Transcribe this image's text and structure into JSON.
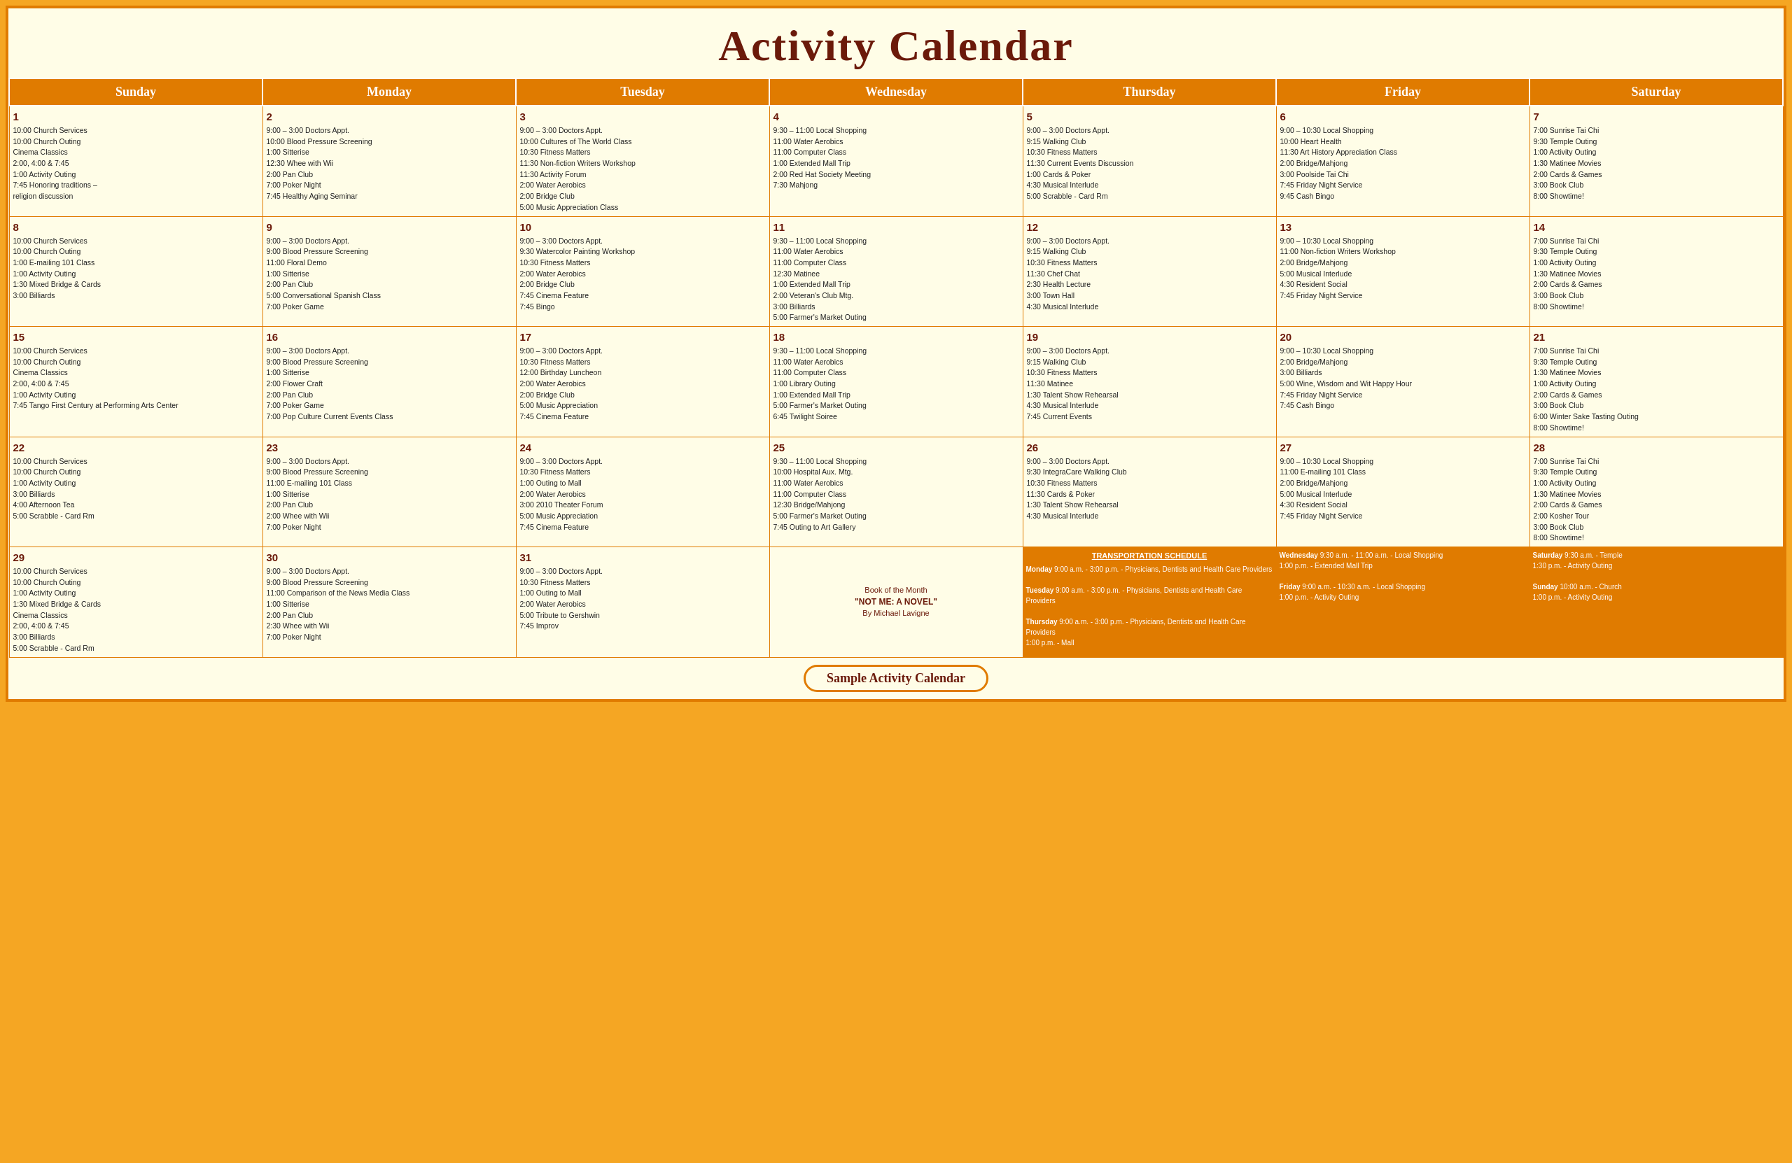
{
  "title": "Activity Calendar",
  "days_of_week": [
    "Sunday",
    "Monday",
    "Tuesday",
    "Wednesday",
    "Thursday",
    "Friday",
    "Saturday"
  ],
  "footer": "Sample Activity Calendar",
  "weeks": [
    {
      "cells": [
        {
          "day": 1,
          "activities": [
            "10:00 Church Services",
            "10:00 Church Outing",
            "Cinema Classics",
            "2:00, 4:00 & 7:45",
            "1:00 Activity Outing",
            "7:45 Honoring traditions –",
            "religion discussion"
          ]
        },
        {
          "day": 2,
          "activities": [
            "9:00 – 3:00 Doctors Appt.",
            "10:00 Blood Pressure Screening",
            "1:00 Sitterise",
            "12:30 Whee with Wii",
            "2:00 Pan Club",
            "7:00 Poker Night",
            "7:45 Healthy Aging Seminar"
          ]
        },
        {
          "day": 3,
          "activities": [
            "9:00 – 3:00 Doctors Appt.",
            "10:00 Cultures of The World Class",
            "10:30 Fitness Matters",
            "11:30 Non-fiction Writers Workshop",
            "11:30 Activity Forum",
            "2:00 Water Aerobics",
            "2:00 Bridge Club",
            "5:00 Music Appreciation Class"
          ]
        },
        {
          "day": 4,
          "activities": [
            "9:30 – 11:00 Local Shopping",
            "11:00 Water Aerobics",
            "11:00 Computer Class",
            "1:00 Extended Mall Trip",
            "2:00 Red Hat Society Meeting",
            "7:30 Mahjong"
          ]
        },
        {
          "day": 5,
          "activities": [
            "9:00 – 3:00 Doctors Appt.",
            "9:15 Walking Club",
            "10:30 Fitness Matters",
            "11:30 Current Events Discussion",
            "1:00 Cards & Poker",
            "4:30 Musical Interlude",
            "5:00 Scrabble - Card Rm"
          ]
        },
        {
          "day": 6,
          "activities": [
            "9:00 – 10:30 Local Shopping",
            "10:00 Heart Health",
            "11:30 Art History Appreciation Class",
            "2:00 Bridge/Mahjong",
            "3:00 Poolside Tai Chi",
            "7:45 Friday Night Service",
            "9:45 Cash Bingo"
          ]
        },
        {
          "day": 7,
          "activities": [
            "7:00 Sunrise Tai Chi",
            "9:30 Temple Outing",
            "1:00 Activity Outing",
            "1:30 Matinee Movies",
            "2:00 Cards & Games",
            "3:00 Book Club",
            "8:00 Showtime!"
          ]
        }
      ]
    },
    {
      "cells": [
        {
          "day": 8,
          "activities": [
            "10:00 Church Services",
            "10:00 Church Outing",
            "1:00 E-mailing 101 Class",
            "1:00 Activity Outing",
            "1:30 Mixed Bridge & Cards",
            "3:00 Billiards"
          ]
        },
        {
          "day": 9,
          "activities": [
            "9:00 – 3:00 Doctors Appt.",
            "9:00 Blood Pressure Screening",
            "11:00 Floral Demo",
            "1:00 Sitterise",
            "2:00 Pan Club",
            "5:00 Conversational Spanish Class",
            "7:00 Poker Game"
          ]
        },
        {
          "day": 10,
          "activities": [
            "9:00 – 3:00 Doctors Appt.",
            "9:30 Watercolor Painting Workshop",
            "10:30 Fitness Matters",
            "2:00 Water Aerobics",
            "2:00 Bridge Club",
            "7:45 Cinema Feature",
            "7:45 Bingo"
          ]
        },
        {
          "day": 11,
          "activities": [
            "9:30 – 11:00 Local Shopping",
            "11:00 Water Aerobics",
            "11:00 Computer Class",
            "12:30 Matinee",
            "1:00 Extended Mall Trip",
            "2:00 Veteran's Club Mtg.",
            "3:00 Billiards",
            "5:00 Farmer's Market Outing"
          ]
        },
        {
          "day": 12,
          "activities": [
            "9:00 – 3:00 Doctors Appt.",
            "9:15 Walking Club",
            "10:30 Fitness Matters",
            "11:30 Chef Chat",
            "2:30 Health Lecture",
            "3:00 Town Hall",
            "4:30 Musical Interlude"
          ]
        },
        {
          "day": 13,
          "activities": [
            "9:00 – 10:30 Local Shopping",
            "11:00 Non-fiction Writers Workshop",
            "2:00 Bridge/Mahjong",
            "5:00 Musical Interlude",
            "4:30 Resident Social",
            "7:45 Friday Night Service"
          ]
        },
        {
          "day": 14,
          "activities": [
            "7:00 Sunrise Tai Chi",
            "9:30 Temple Outing",
            "1:00 Activity Outing",
            "1:30 Matinee Movies",
            "2:00 Cards & Games",
            "3:00 Book Club",
            "8:00 Showtime!"
          ]
        }
      ]
    },
    {
      "cells": [
        {
          "day": 15,
          "activities": [
            "10:00 Church Services",
            "10:00 Church Outing",
            "Cinema Classics",
            "2:00, 4:00 & 7:45",
            "1:00 Activity Outing",
            "7:45 Tango First Century at Performing Arts Center"
          ]
        },
        {
          "day": 16,
          "activities": [
            "9:00 – 3:00 Doctors Appt.",
            "9:00 Blood Pressure Screening",
            "1:00 Sitterise",
            "2:00 Flower Craft",
            "2:00 Pan Club",
            "7:00 Poker Game",
            "7:00 Pop Culture Current Events Class"
          ]
        },
        {
          "day": 17,
          "activities": [
            "9:00 – 3:00 Doctors Appt.",
            "10:30 Fitness Matters",
            "12:00 Birthday Luncheon",
            "2:00 Water Aerobics",
            "2:00 Bridge Club",
            "5:00 Music Appreciation",
            "7:45 Cinema Feature"
          ]
        },
        {
          "day": 18,
          "activities": [
            "9:30 – 11:00 Local Shopping",
            "11:00 Water Aerobics",
            "11:00 Computer Class",
            "1:00 Library Outing",
            "1:00 Extended Mall Trip",
            "5:00 Farmer's Market Outing",
            "6:45 Twilight Soiree"
          ]
        },
        {
          "day": 19,
          "activities": [
            "9:00 – 3:00 Doctors Appt.",
            "9:15 Walking Club",
            "10:30 Fitness Matters",
            "11:30 Matinee",
            "1:30 Talent Show Rehearsal",
            "4:30 Musical Interlude",
            "7:45 Current Events"
          ]
        },
        {
          "day": 20,
          "activities": [
            "9:00 – 10:30 Local Shopping",
            "2:00 Bridge/Mahjong",
            "3:00 Billiards",
            "5:00 Wine, Wisdom and Wit Happy Hour",
            "7:45 Friday Night Service",
            "7:45 Cash Bingo"
          ]
        },
        {
          "day": 21,
          "activities": [
            "7:00 Sunrise Tai Chi",
            "9:30 Temple Outing",
            "1:30 Matinee Movies",
            "1:00 Activity Outing",
            "2:00 Cards & Games",
            "3:00 Book Club",
            "6:00 Winter Sake Tasting Outing",
            "8:00 Showtime!"
          ]
        }
      ]
    },
    {
      "cells": [
        {
          "day": 22,
          "activities": [
            "10:00 Church Services",
            "10:00 Church Outing",
            "1:00 Activity Outing",
            "3:00 Billiards",
            "4:00 Afternoon Tea",
            "5:00 Scrabble - Card Rm"
          ]
        },
        {
          "day": 23,
          "activities": [
            "9:00 – 3:00 Doctors Appt.",
            "9:00 Blood Pressure Screening",
            "11:00 E-mailing 101 Class",
            "1:00 Sitterise",
            "2:00 Pan Club",
            "2:00 Whee with Wii",
            "7:00 Poker Night"
          ]
        },
        {
          "day": 24,
          "activities": [
            "9:00 – 3:00 Doctors Appt.",
            "10:30 Fitness Matters",
            "1:00 Outing to Mall",
            "2:00 Water Aerobics",
            "3:00 2010 Theater Forum",
            "5:00 Music Appreciation",
            "7:45 Cinema Feature"
          ]
        },
        {
          "day": 25,
          "activities": [
            "9:30 – 11:00 Local Shopping",
            "10:00 Hospital Aux. Mtg.",
            "11:00 Water Aerobics",
            "11:00 Computer Class",
            "12:30 Bridge/Mahjong",
            "5:00 Farmer's Market Outing",
            "7:45 Outing to Art Gallery"
          ]
        },
        {
          "day": 26,
          "activities": [
            "9:00 – 3:00 Doctors Appt.",
            "9:30 IntegraCare Walking Club",
            "10:30 Fitness Matters",
            "11:30 Cards & Poker",
            "1:30 Talent Show Rehearsal",
            "4:30 Musical Interlude"
          ]
        },
        {
          "day": 27,
          "activities": [
            "9:00 – 10:30 Local Shopping",
            "11:00 E-mailing 101 Class",
            "2:00 Bridge/Mahjong",
            "5:00 Musical Interlude",
            "4:30 Resident Social",
            "7:45 Friday Night Service"
          ]
        },
        {
          "day": 28,
          "activities": [
            "7:00 Sunrise Tai Chi",
            "9:30 Temple Outing",
            "1:00 Activity Outing",
            "1:30 Matinee Movies",
            "2:00 Cards & Games",
            "2:00 Kosher Tour",
            "3:00 Book Club",
            "8:00 Showtime!"
          ]
        }
      ]
    },
    {
      "cells": [
        {
          "day": 29,
          "activities": [
            "10:00 Church Services",
            "10:00 Church Outing",
            "1:00 Activity Outing",
            "1:30 Mixed Bridge & Cards",
            "Cinema Classics",
            "2:00, 4:00 & 7:45",
            "3:00 Billiards",
            "5:00 Scrabble - Card Rm"
          ]
        },
        {
          "day": 30,
          "activities": [
            "9:00 – 3:00 Doctors Appt.",
            "9:00 Blood Pressure Screening",
            "11:00 Comparison of the News Media Class",
            "1:00 Sitterise",
            "2:00 Pan Club",
            "2:30 Whee with Wii",
            "7:00 Poker Night"
          ]
        },
        {
          "day": 31,
          "activities": [
            "9:00 – 3:00 Doctors Appt.",
            "10:30 Fitness Matters",
            "1:00 Outing to Mall",
            "2:00 Water Aerobics",
            "5:00 Tribute to Gershwin",
            "7:45 Improv"
          ]
        },
        {
          "day": "book",
          "book_title": "Book of the Month",
          "book_name": "\"NOT ME: A NOVEL\"",
          "book_author": "By Michael Lavigne"
        },
        {
          "day": "transport_thu",
          "transport": true
        },
        {
          "day": "transport_fri",
          "transport": true
        },
        {
          "day": "transport_sat",
          "transport": true
        }
      ]
    }
  ],
  "transport": {
    "header": "TRANSPORTATION SCHEDULE",
    "monday": {
      "label": "Monday",
      "text": "9:00 a.m. - 3:00 p.m. - Physicians, Dentists and Health Care Providers"
    },
    "tuesday": {
      "label": "Tuesday",
      "text": "9:00 a.m. - 3:00 p.m. - Physicians, Dentists and Health Care Providers"
    },
    "wednesday": {
      "label": "Wednesday",
      "text": "9:30 a.m. - 11:00 a.m. - Local Shopping\n1:00 p.m. - Extended Mall Trip"
    },
    "thursday": {
      "label": "Thursday",
      "text": "9:00 a.m. - 3:00 p.m. - Physicians, Dentists and Health Care Providers\n1:00 p.m. - Mall"
    },
    "friday": {
      "label": "Friday",
      "text": "9:00 a.m. - 10:30 a.m. - Local Shopping\n1:00 p.m. - Activity Outing"
    },
    "saturday": {
      "label": "Saturday",
      "text": "9:30 a.m. - Temple\n1:30 p.m. - Activity Outing"
    },
    "sunday": {
      "label": "Sunday",
      "text": "10:00 a.m. - Church\n1:00 p.m. - Activity Outing"
    }
  }
}
